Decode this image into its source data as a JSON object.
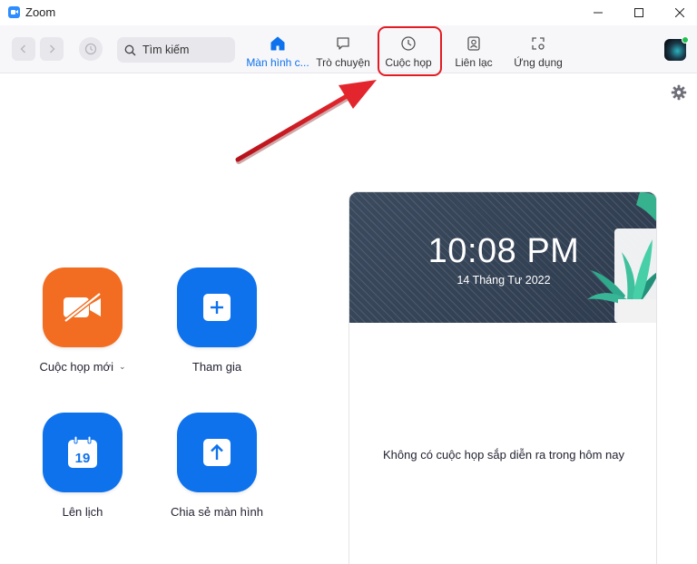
{
  "window": {
    "title": "Zoom"
  },
  "toolbar": {
    "search_placeholder": "Tìm kiếm",
    "tabs": [
      {
        "label": "Màn hình c...",
        "icon": "home-icon",
        "active": true
      },
      {
        "label": "Trò chuyện",
        "icon": "chat-icon",
        "active": false
      },
      {
        "label": "Cuộc họp",
        "icon": "clock-icon",
        "active": false
      },
      {
        "label": "Liên lạc",
        "icon": "contacts-icon",
        "active": false
      },
      {
        "label": "Ứng dụng",
        "icon": "apps-icon",
        "active": false
      }
    ]
  },
  "actions": {
    "new_meeting": {
      "label": "Cuộc họp mới",
      "icon": "video-off-icon"
    },
    "join": {
      "label": "Tham gia",
      "icon": "plus-icon"
    },
    "schedule": {
      "label": "Lên lịch",
      "icon": "calendar-icon",
      "day": "19"
    },
    "share_screen": {
      "label": "Chia sẻ màn hình",
      "icon": "share-up-icon"
    }
  },
  "clock": {
    "time": "10:08 PM",
    "date": "14 Tháng Tư 2022",
    "empty_message": "Không có cuộc họp sắp diễn ra trong hôm nay"
  },
  "colors": {
    "accent_blue": "#0E72ED",
    "orange": "#F26D21",
    "highlight_red": "#E31B23",
    "card_header": "#2E3B4E"
  }
}
